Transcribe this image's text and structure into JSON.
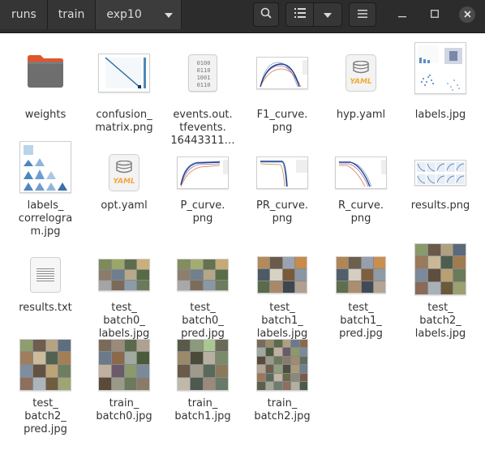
{
  "breadcrumbs": [
    {
      "label": "runs"
    },
    {
      "label": "train"
    },
    {
      "label": "exp10"
    }
  ],
  "toolbar": {
    "search_icon": "search-icon",
    "list_view_icon": "list-view-icon",
    "view_options_icon": "chevron-down-icon",
    "menu_icon": "hamburger-menu-icon"
  },
  "window": {
    "minimize": "—",
    "maximize": "□",
    "close": "✕"
  },
  "files": [
    {
      "name": "weights",
      "kind": "folder"
    },
    {
      "name": "confusion_\nmatrix.png",
      "kind": "matrix"
    },
    {
      "name": "events.out.\ntfevents.\n16443311…",
      "kind": "binary"
    },
    {
      "name": "F1_curve.\npng",
      "kind": "curve"
    },
    {
      "name": "hyp.yaml",
      "kind": "yaml"
    },
    {
      "name": "labels.jpg",
      "kind": "labels"
    },
    {
      "name": "labels_\ncorrelogra\nm.jpg",
      "kind": "correlogram"
    },
    {
      "name": "opt.yaml",
      "kind": "yaml"
    },
    {
      "name": "P_curve.\npng",
      "kind": "curve"
    },
    {
      "name": "PR_curve.\npng",
      "kind": "prcurve"
    },
    {
      "name": "R_curve.\npng",
      "kind": "curve"
    },
    {
      "name": "results.png",
      "kind": "results"
    },
    {
      "name": "results.txt",
      "kind": "text"
    },
    {
      "name": "test_\nbatch0_\nlabels.jpg",
      "kind": "photo-wide"
    },
    {
      "name": "test_\nbatch0_\npred.jpg",
      "kind": "photo-wide"
    },
    {
      "name": "test_\nbatch1_\nlabels.jpg",
      "kind": "photo-wide"
    },
    {
      "name": "test_\nbatch1_\npred.jpg",
      "kind": "photo-wide"
    },
    {
      "name": "test_\nbatch2_\nlabels.jpg",
      "kind": "photo-square"
    },
    {
      "name": "test_\nbatch2_\npred.jpg",
      "kind": "photo-square"
    },
    {
      "name": "train_\nbatch0.jpg",
      "kind": "photo-square"
    },
    {
      "name": "train_\nbatch1.jpg",
      "kind": "photo-square"
    },
    {
      "name": "train_\nbatch2.jpg",
      "kind": "photo-square"
    }
  ],
  "colors": {
    "headerbar": "#2c2c2c",
    "folder": "#6e6e6e",
    "folder_tab": "#e0552b",
    "yaml_orange": "#f0a93b"
  }
}
